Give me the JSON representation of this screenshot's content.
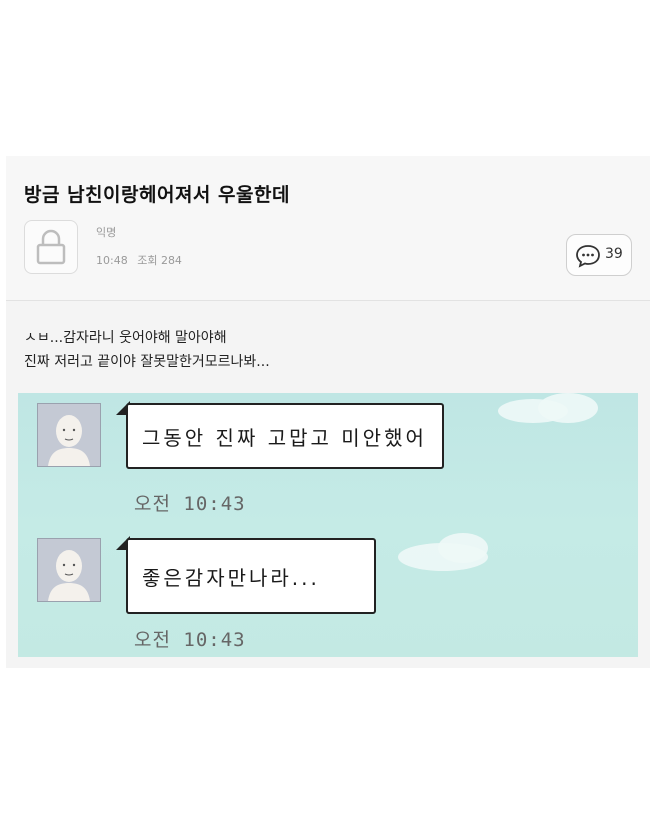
{
  "post": {
    "title": "방금 남친이랑헤어져서 우울한데",
    "author": "익명",
    "time": "10:48",
    "views_label": "조회 284",
    "comment_count": "39"
  },
  "body": {
    "line1": "ㅅㅂ...감자라니 웃어야해 말아야해",
    "line2": "진짜 저러고 끝이야 잘못말한거모르나봐..."
  },
  "chat": {
    "messages": [
      {
        "text": "그동안 진짜 고맙고 미안했어",
        "time": "오전 10:43"
      },
      {
        "text": "좋은감자만나라...",
        "time": "오전 10:43"
      }
    ]
  },
  "icons": {
    "lock": "lock-icon",
    "comment": "speech-bubble-icon",
    "avatar": "default-profile-icon"
  },
  "colors": {
    "chat_background": "#c2e8e4",
    "bubble_border": "#222222",
    "meta_text": "#9a9a9a"
  }
}
